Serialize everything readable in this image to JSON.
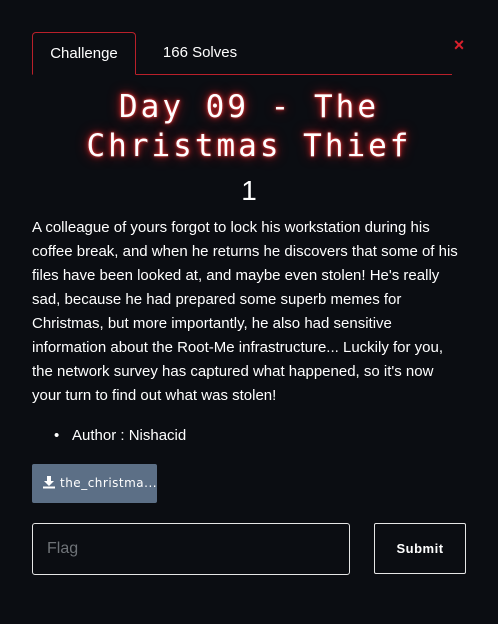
{
  "tabs": {
    "challenge": "Challenge",
    "solves": "166 Solves"
  },
  "close_symbol": "×",
  "challenge": {
    "title": "Day 09 - The Christmas Thief",
    "value": "1",
    "description": "A colleague of yours forgot to lock his workstation during his coffee break, and when he returns he discovers that some of his files have been looked at, and maybe even stolen! He's really sad, because he had prepared some superb memes for Christmas, but more importantly, he also had sensitive information about the Root-Me infrastructure... Luckily for you, the network survey has captured what happened, so it's now your turn to find out what was stolen!",
    "author_bullet": "•",
    "author": "Author : Nishacid",
    "file_label": "the_christma..."
  },
  "form": {
    "flag_placeholder": "Flag",
    "submit_label": "Submit"
  },
  "icons": {
    "close": "close-icon",
    "download": "download-icon"
  },
  "colors": {
    "background": "#0b0d12",
    "accent_red": "#b9202a",
    "close_red": "#d9202c",
    "file_button": "#5c6f86",
    "title_glow": "#e02a2a"
  }
}
